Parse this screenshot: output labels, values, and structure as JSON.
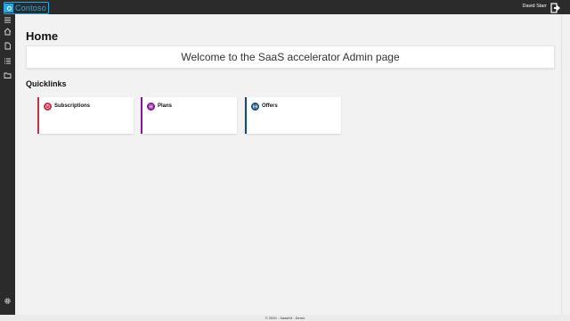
{
  "header": {
    "logo_text": "Contoso",
    "user_name": "David Starr",
    "brand_color": "#29a8e0",
    "signout_icon": "sign-out-icon"
  },
  "sidebar": {
    "items": [
      {
        "icon": "menu-icon"
      },
      {
        "icon": "home-icon"
      },
      {
        "icon": "document-icon"
      },
      {
        "icon": "list-icon"
      },
      {
        "icon": "folder-icon"
      },
      {
        "icon": "gear-icon"
      }
    ]
  },
  "main": {
    "title": "Home",
    "welcome": "Welcome to the SaaS accelerator Admin page",
    "quicklinks_title": "Quicklinks",
    "quicklinks": [
      {
        "label": "Subscriptions",
        "color": "#c4314b",
        "icon": "subscriptions-icon"
      },
      {
        "label": "Plans",
        "color": "#881798",
        "icon": "plans-icon"
      },
      {
        "label": "Offers",
        "color": "#0f4c81",
        "icon": "offers-icon"
      }
    ]
  },
  "footer": {
    "text": "© 2020 - SaasKit - Demo"
  }
}
